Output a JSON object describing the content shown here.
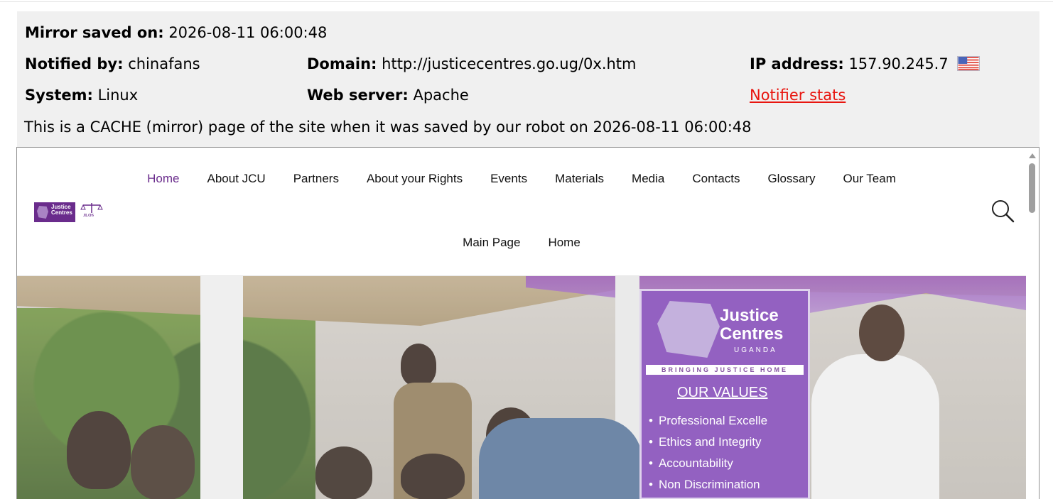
{
  "mirror": {
    "saved_label": "Mirror saved on:",
    "saved_value": "2026-08-11 06:00:48",
    "notified_label": "Notified by:",
    "notified_value": "chinafans",
    "domain_label": "Domain:",
    "domain_value": "http://justicecentres.go.ug/0x.htm",
    "ip_label": "IP address:",
    "ip_value": "157.90.245.7",
    "flag_icon": "us-flag-icon",
    "system_label": "System:",
    "system_value": "Linux",
    "webserver_label": "Web server:",
    "webserver_value": "Apache",
    "stats_link": "Notifier stats",
    "cache_notice": "This is a CACHE (mirror) page of the site when it was saved by our robot on 2026-08-11 06:00:48"
  },
  "site": {
    "logo_text": "Justice Centres",
    "logo_sub": "UGANDA",
    "logo2_text": "JLOS",
    "nav_primary": [
      "Home",
      "About JCU",
      "Partners",
      "About your Rights",
      "Events",
      "Materials",
      "Media",
      "Contacts",
      "Glossary",
      "Our Team"
    ],
    "nav_secondary": [
      "Main Page",
      "Home"
    ],
    "search_icon": "search-icon"
  },
  "hero": {
    "banner_title": "Justice Centres",
    "banner_sub": "UGANDA",
    "banner_strip": "BRINGING JUSTICE HOME",
    "values_heading": "OUR VALUES",
    "values": [
      "Professional Excelle",
      "Ethics and Integrity",
      "Accountability",
      "Non Discrimination"
    ]
  },
  "colors": {
    "accent": "#6a2c8c",
    "link_red": "#e8150f",
    "panel_bg": "#f0f0f0"
  }
}
